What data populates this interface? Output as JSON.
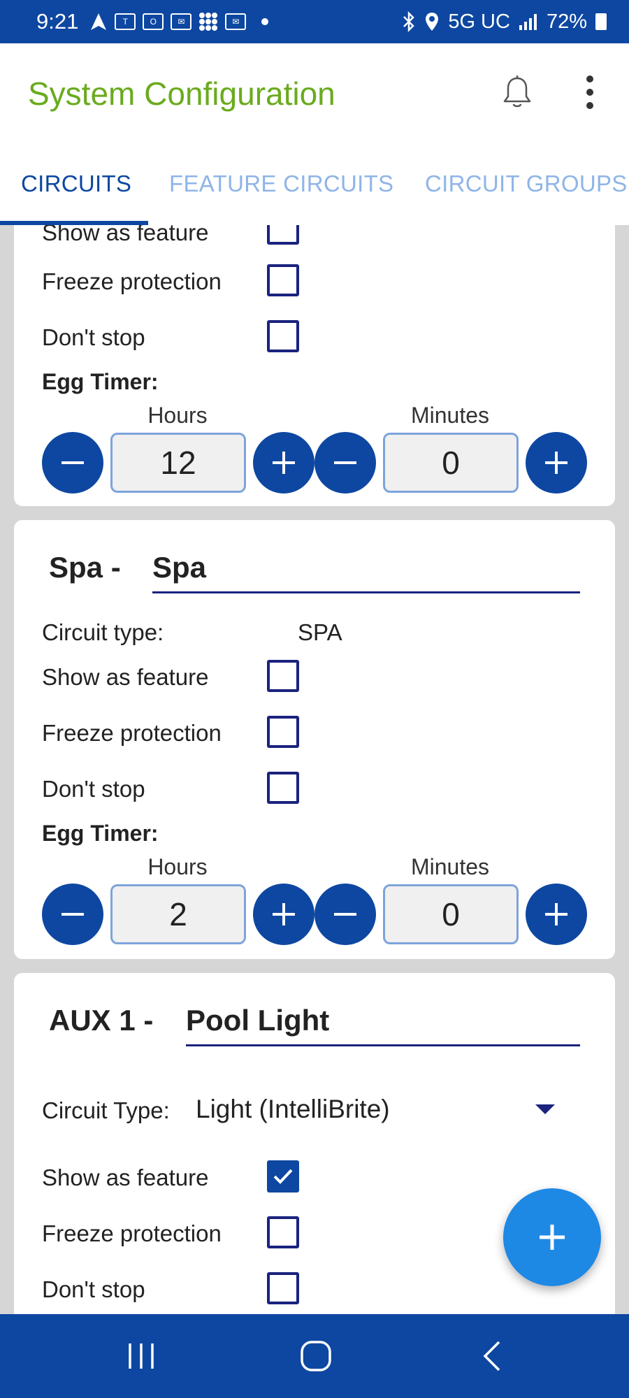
{
  "status_bar": {
    "time": "9:21",
    "network": "5G UC",
    "battery": "72%"
  },
  "app_bar": {
    "title": "System Configuration"
  },
  "tabs": [
    {
      "label": "CIRCUITS",
      "active": true
    },
    {
      "label": "FEATURE CIRCUITS",
      "active": false
    },
    {
      "label": "CIRCUIT GROUPS",
      "active": false
    }
  ],
  "cards": {
    "partial": {
      "show_as_feature": "Show as feature",
      "freeze_protection": "Freeze protection",
      "dont_stop": "Don't stop",
      "egg_timer": "Egg Timer:",
      "hours_label": "Hours",
      "minutes_label": "Minutes",
      "hours_value": "12",
      "minutes_value": "0"
    },
    "spa": {
      "prefix": "Spa -",
      "name": "Spa",
      "circuit_type_label": "Circuit type:",
      "circuit_type_value": "SPA",
      "show_as_feature": "Show as feature",
      "freeze_protection": "Freeze protection",
      "dont_stop": "Don't stop",
      "egg_timer": "Egg Timer:",
      "hours_label": "Hours",
      "minutes_label": "Minutes",
      "hours_value": "2",
      "minutes_value": "0"
    },
    "aux1": {
      "prefix": "AUX 1 -",
      "name": "Pool Light",
      "circuit_type_label": "Circuit Type:",
      "circuit_type_value": "Light (IntelliBrite)",
      "show_as_feature": "Show as feature",
      "show_as_feature_checked": true,
      "freeze_protection": "Freeze protection",
      "dont_stop": "Don't stop"
    }
  },
  "colors": {
    "primary": "#0d47a1",
    "title_green": "#6aab1e",
    "tab_inactive": "#8fb5e8",
    "fab": "#1e88e5"
  }
}
